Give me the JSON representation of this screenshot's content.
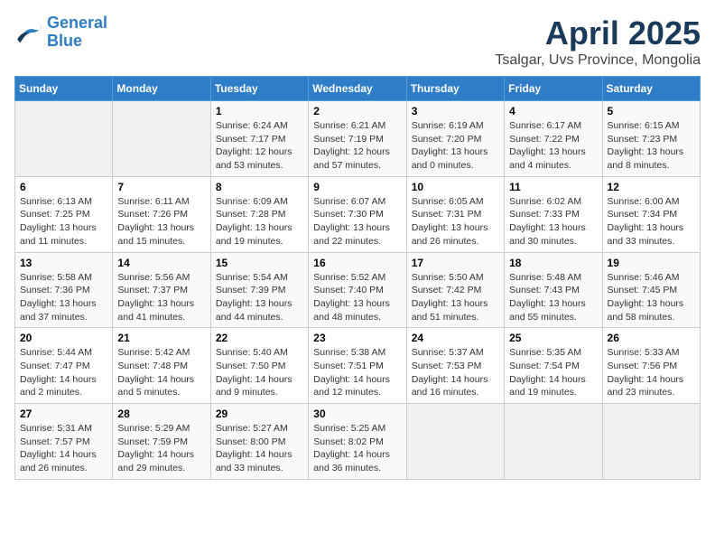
{
  "header": {
    "logo_line1": "General",
    "logo_line2": "Blue",
    "title": "April 2025",
    "subtitle": "Tsalgar, Uvs Province, Mongolia"
  },
  "weekdays": [
    "Sunday",
    "Monday",
    "Tuesday",
    "Wednesday",
    "Thursday",
    "Friday",
    "Saturday"
  ],
  "weeks": [
    [
      {
        "day": "",
        "empty": true
      },
      {
        "day": "",
        "empty": true
      },
      {
        "day": "1",
        "sunrise": "6:24 AM",
        "sunset": "7:17 PM",
        "daylight": "12 hours and 53 minutes."
      },
      {
        "day": "2",
        "sunrise": "6:21 AM",
        "sunset": "7:19 PM",
        "daylight": "12 hours and 57 minutes."
      },
      {
        "day": "3",
        "sunrise": "6:19 AM",
        "sunset": "7:20 PM",
        "daylight": "13 hours and 0 minutes."
      },
      {
        "day": "4",
        "sunrise": "6:17 AM",
        "sunset": "7:22 PM",
        "daylight": "13 hours and 4 minutes."
      },
      {
        "day": "5",
        "sunrise": "6:15 AM",
        "sunset": "7:23 PM",
        "daylight": "13 hours and 8 minutes."
      }
    ],
    [
      {
        "day": "6",
        "sunrise": "6:13 AM",
        "sunset": "7:25 PM",
        "daylight": "13 hours and 11 minutes."
      },
      {
        "day": "7",
        "sunrise": "6:11 AM",
        "sunset": "7:26 PM",
        "daylight": "13 hours and 15 minutes."
      },
      {
        "day": "8",
        "sunrise": "6:09 AM",
        "sunset": "7:28 PM",
        "daylight": "13 hours and 19 minutes."
      },
      {
        "day": "9",
        "sunrise": "6:07 AM",
        "sunset": "7:30 PM",
        "daylight": "13 hours and 22 minutes."
      },
      {
        "day": "10",
        "sunrise": "6:05 AM",
        "sunset": "7:31 PM",
        "daylight": "13 hours and 26 minutes."
      },
      {
        "day": "11",
        "sunrise": "6:02 AM",
        "sunset": "7:33 PM",
        "daylight": "13 hours and 30 minutes."
      },
      {
        "day": "12",
        "sunrise": "6:00 AM",
        "sunset": "7:34 PM",
        "daylight": "13 hours and 33 minutes."
      }
    ],
    [
      {
        "day": "13",
        "sunrise": "5:58 AM",
        "sunset": "7:36 PM",
        "daylight": "13 hours and 37 minutes."
      },
      {
        "day": "14",
        "sunrise": "5:56 AM",
        "sunset": "7:37 PM",
        "daylight": "13 hours and 41 minutes."
      },
      {
        "day": "15",
        "sunrise": "5:54 AM",
        "sunset": "7:39 PM",
        "daylight": "13 hours and 44 minutes."
      },
      {
        "day": "16",
        "sunrise": "5:52 AM",
        "sunset": "7:40 PM",
        "daylight": "13 hours and 48 minutes."
      },
      {
        "day": "17",
        "sunrise": "5:50 AM",
        "sunset": "7:42 PM",
        "daylight": "13 hours and 51 minutes."
      },
      {
        "day": "18",
        "sunrise": "5:48 AM",
        "sunset": "7:43 PM",
        "daylight": "13 hours and 55 minutes."
      },
      {
        "day": "19",
        "sunrise": "5:46 AM",
        "sunset": "7:45 PM",
        "daylight": "13 hours and 58 minutes."
      }
    ],
    [
      {
        "day": "20",
        "sunrise": "5:44 AM",
        "sunset": "7:47 PM",
        "daylight": "14 hours and 2 minutes."
      },
      {
        "day": "21",
        "sunrise": "5:42 AM",
        "sunset": "7:48 PM",
        "daylight": "14 hours and 5 minutes."
      },
      {
        "day": "22",
        "sunrise": "5:40 AM",
        "sunset": "7:50 PM",
        "daylight": "14 hours and 9 minutes."
      },
      {
        "day": "23",
        "sunrise": "5:38 AM",
        "sunset": "7:51 PM",
        "daylight": "14 hours and 12 minutes."
      },
      {
        "day": "24",
        "sunrise": "5:37 AM",
        "sunset": "7:53 PM",
        "daylight": "14 hours and 16 minutes."
      },
      {
        "day": "25",
        "sunrise": "5:35 AM",
        "sunset": "7:54 PM",
        "daylight": "14 hours and 19 minutes."
      },
      {
        "day": "26",
        "sunrise": "5:33 AM",
        "sunset": "7:56 PM",
        "daylight": "14 hours and 23 minutes."
      }
    ],
    [
      {
        "day": "27",
        "sunrise": "5:31 AM",
        "sunset": "7:57 PM",
        "daylight": "14 hours and 26 minutes."
      },
      {
        "day": "28",
        "sunrise": "5:29 AM",
        "sunset": "7:59 PM",
        "daylight": "14 hours and 29 minutes."
      },
      {
        "day": "29",
        "sunrise": "5:27 AM",
        "sunset": "8:00 PM",
        "daylight": "14 hours and 33 minutes."
      },
      {
        "day": "30",
        "sunrise": "5:25 AM",
        "sunset": "8:02 PM",
        "daylight": "14 hours and 36 minutes."
      },
      {
        "day": "",
        "empty": true
      },
      {
        "day": "",
        "empty": true
      },
      {
        "day": "",
        "empty": true
      }
    ]
  ]
}
